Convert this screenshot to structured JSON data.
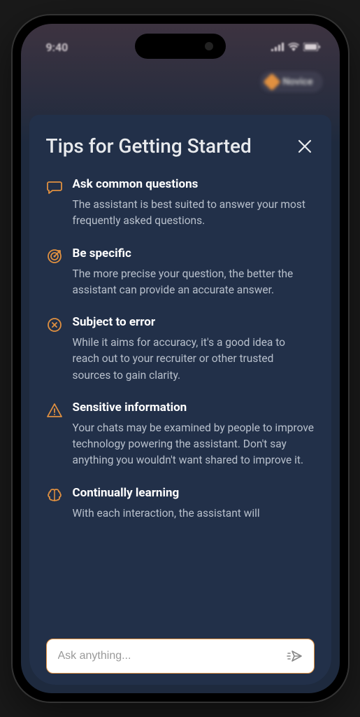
{
  "status": {
    "time": "9:40"
  },
  "badge": {
    "label": "Novice"
  },
  "panel": {
    "title": "Tips for Getting Started"
  },
  "tips": [
    {
      "title": "Ask common questions",
      "desc": "The assistant is best suited to answer your most frequently asked questions."
    },
    {
      "title": "Be specific",
      "desc": "The more precise your question, the better the assistant can provide an accurate answer."
    },
    {
      "title": "Subject to error",
      "desc": "While it aims for accuracy, it's a good idea to reach out to your recruiter or other trusted sources to gain clarity."
    },
    {
      "title": "Sensitive information",
      "desc": "Your chats may be examined by people to improve technology powering the assistant. Don't say anything you wouldn't want shared to improve it."
    },
    {
      "title": "Continually learning",
      "desc": "With each interaction, the assistant will"
    }
  ],
  "input": {
    "placeholder": "Ask anything..."
  }
}
